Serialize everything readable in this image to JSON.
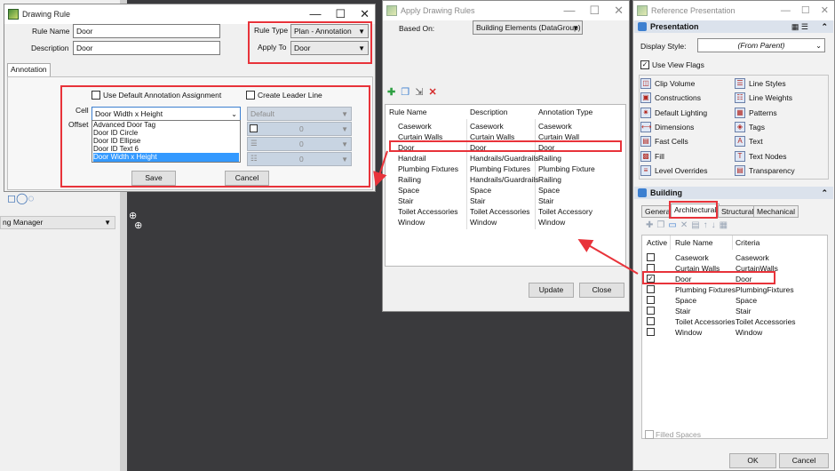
{
  "drawing_rule": {
    "title": "Drawing Rule",
    "rule_name_label": "Rule Name",
    "rule_name_value": "Door",
    "description_label": "Description",
    "description_value": "Door",
    "rule_type_label": "Rule Type",
    "rule_type_value": "Plan - Annotation",
    "apply_to_label": "Apply To",
    "apply_to_value": "Door",
    "tab_annotation": "Annotation",
    "use_default_label": "Use Default Annotation Assignment",
    "create_leader_label": "Create Leader Line",
    "cell_label": "Cell",
    "cell_value": "Door Width x Height",
    "offset_label": "Offset",
    "default_value": "Default",
    "cell_options": [
      "Advanced Door Tag",
      "Door ID Circle",
      "Door ID Ellipse",
      "Door ID Text 6",
      "Door Width x Height"
    ],
    "zero": "0",
    "save": "Save",
    "cancel": "Cancel"
  },
  "manager": {
    "label": "ng Manager"
  },
  "apply_rules": {
    "title": "Apply Drawing Rules",
    "based_on_label": "Based On:",
    "based_on_value": "Building Elements (DataGroup)",
    "col_rule": "Rule Name",
    "col_desc": "Description",
    "col_annot": "Annotation Type",
    "rows": [
      {
        "rule": "Casework",
        "desc": "Casework",
        "annot": "Casework"
      },
      {
        "rule": "Curtain Walls",
        "desc": "Curtain Walls",
        "annot": "Curtain Wall"
      },
      {
        "rule": "Door",
        "desc": "Door",
        "annot": "Door"
      },
      {
        "rule": "Handrail",
        "desc": "Handrails/Guardrails",
        "annot": "Railing"
      },
      {
        "rule": "Plumbing Fixtures",
        "desc": "Plumbing Fixtures",
        "annot": "Plumbing Fixture"
      },
      {
        "rule": "Railing",
        "desc": "Handrails/Guardrails",
        "annot": "Railing"
      },
      {
        "rule": "Space",
        "desc": "Space",
        "annot": "Space"
      },
      {
        "rule": "Stair",
        "desc": "Stair",
        "annot": "Stair"
      },
      {
        "rule": "Toilet Accessories",
        "desc": "Toilet Accessories",
        "annot": "Toilet Accessory"
      },
      {
        "rule": "Window",
        "desc": "Window",
        "annot": "Window"
      }
    ],
    "update": "Update",
    "close": "Close"
  },
  "ref_pres": {
    "title": "Reference Presentation",
    "presentation_header": "Presentation",
    "display_style_label": "Display Style:",
    "display_style_value": "(From Parent)",
    "use_view_flags": "Use View Flags",
    "items_left": [
      "Clip Volume",
      "Constructions",
      "Default Lighting",
      "Dimensions",
      "Fast Cells",
      "Fill",
      "Level Overrides"
    ],
    "items_right": [
      "Line Styles",
      "Line Weights",
      "Patterns",
      "Tags",
      "Text",
      "Text Nodes",
      "Transparency"
    ],
    "building_header": "Building",
    "tabs": [
      "General",
      "Architectural",
      "Structural",
      "Mechanical"
    ],
    "col_active": "Active",
    "col_rule": "Rule Name",
    "col_criteria": "Criteria",
    "rows": [
      {
        "rule": "Casework",
        "criteria": "Casework"
      },
      {
        "rule": "Curtain Walls",
        "criteria": "CurtainWalls"
      },
      {
        "rule": "Door",
        "criteria": "Door"
      },
      {
        "rule": "Plumbing Fixtures",
        "criteria": "PlumbingFixtures"
      },
      {
        "rule": "Space",
        "criteria": "Space"
      },
      {
        "rule": "Stair",
        "criteria": "Stair"
      },
      {
        "rule": "Toilet Accessories",
        "criteria": "Toilet Accessories"
      },
      {
        "rule": "Window",
        "criteria": "Window"
      }
    ],
    "filled_spaces": "Filled Spaces",
    "ok": "OK",
    "cancel": "Cancel"
  }
}
